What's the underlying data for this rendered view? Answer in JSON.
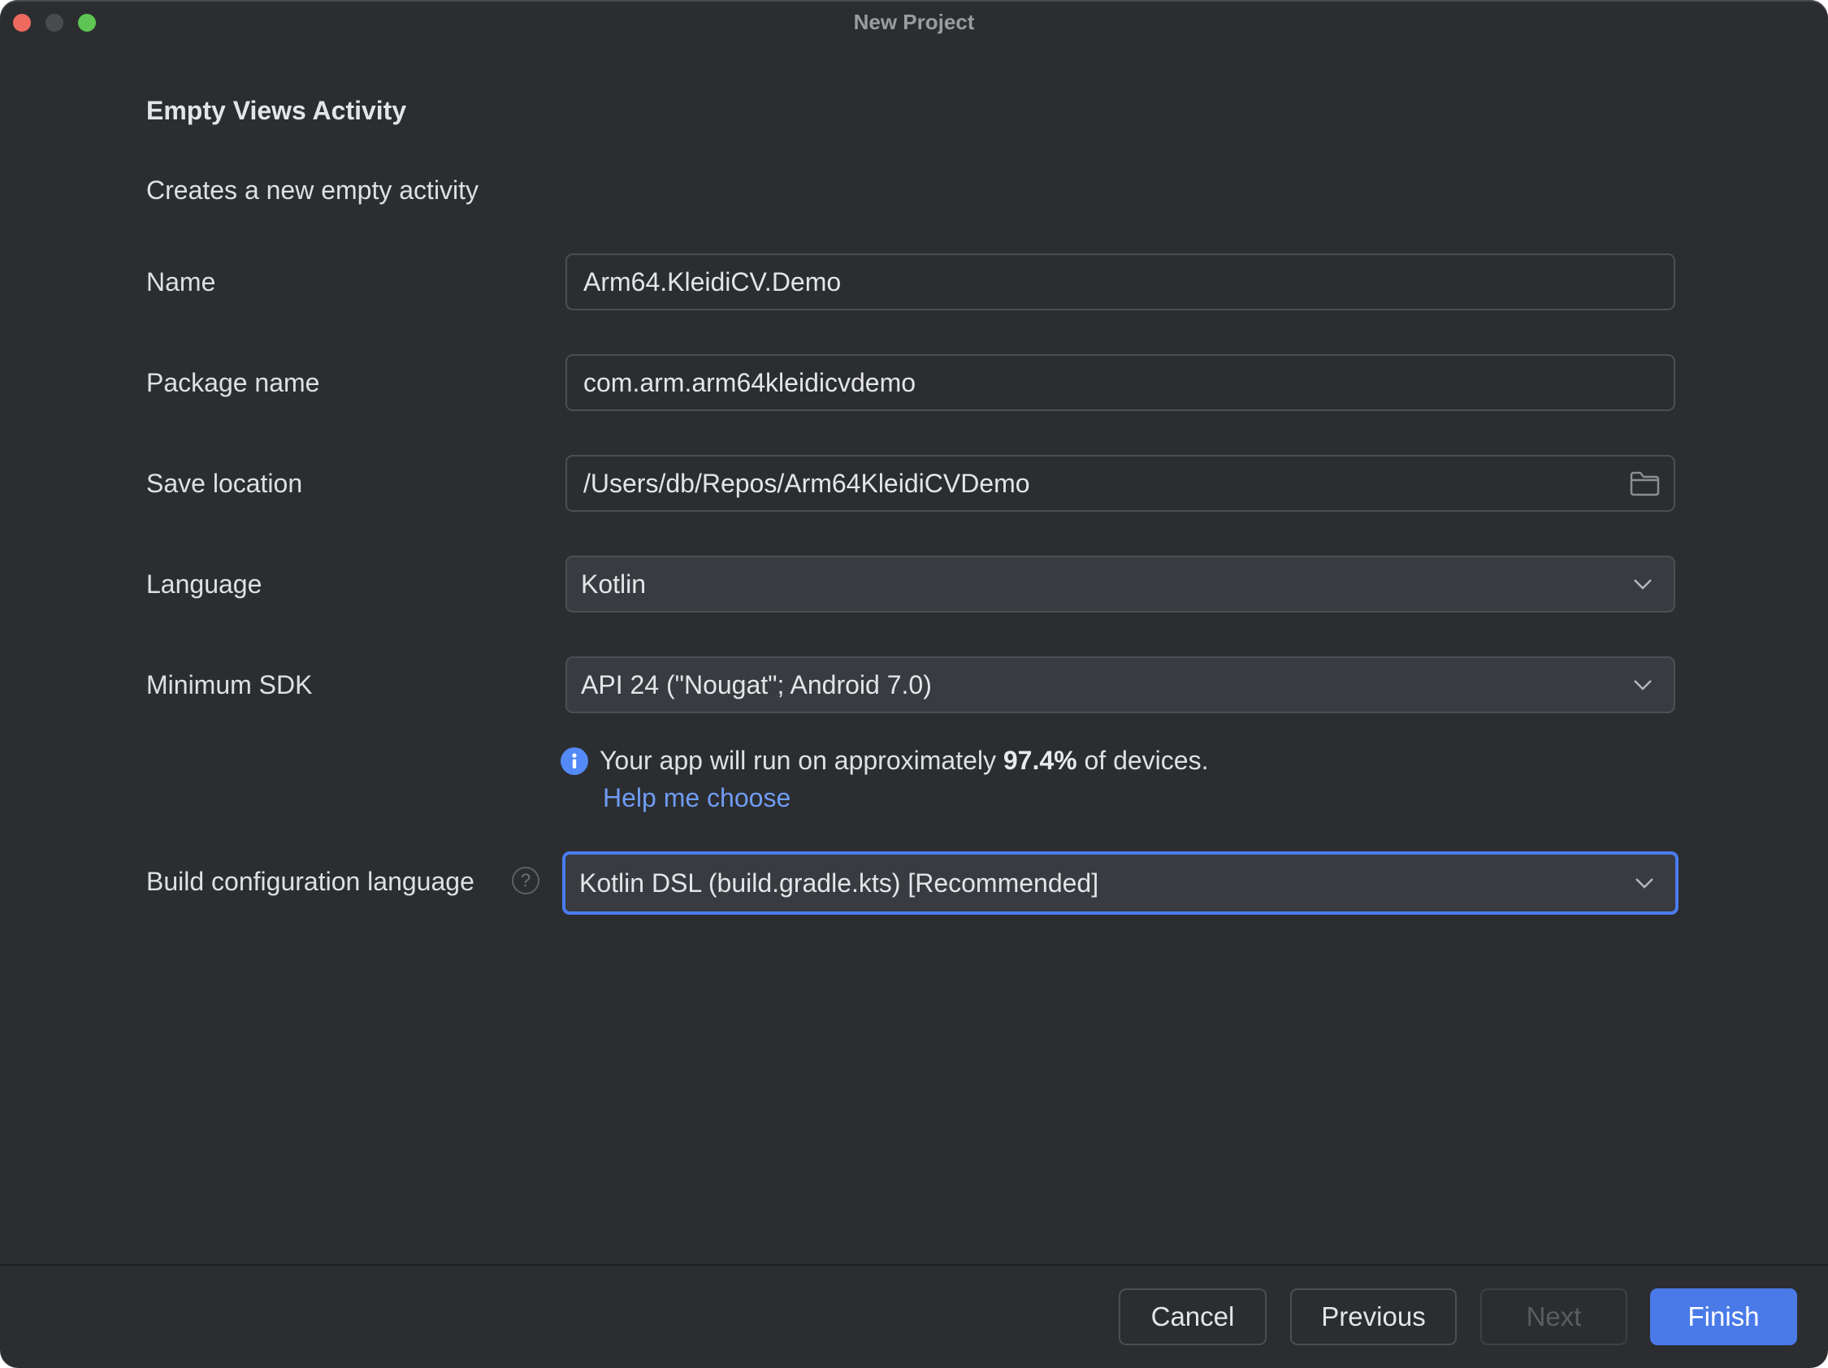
{
  "window": {
    "title": "New Project",
    "controls": [
      "close",
      "minimize",
      "maximize"
    ]
  },
  "header": {
    "title": "Empty Views Activity",
    "description": "Creates a new empty activity"
  },
  "form": {
    "name": {
      "label": "Name",
      "value": "Arm64.KleidiCV.Demo"
    },
    "package_name": {
      "label": "Package name",
      "value": "com.arm.arm64kleidicvdemo"
    },
    "save_location": {
      "label": "Save location",
      "value": "/Users/db/Repos/Arm64KleidiCVDemo",
      "icon": "folder-icon"
    },
    "language": {
      "label": "Language",
      "selected": "Kotlin",
      "icon": "chevron-down-icon"
    },
    "minimum_sdk": {
      "label": "Minimum SDK",
      "selected": "API 24 (\"Nougat\"; Android 7.0)",
      "icon": "chevron-down-icon"
    },
    "sdk_info": {
      "icon": "info-icon",
      "prefix": "Your app will run on approximately ",
      "percentage": "97.4%",
      "suffix": " of devices.",
      "link": "Help me choose"
    },
    "build_config_language": {
      "label": "Build configuration language",
      "help_icon": "question-icon",
      "selected": "Kotlin DSL (build.gradle.kts) [Recommended]",
      "focused": true
    }
  },
  "footer": {
    "cancel": "Cancel",
    "previous": "Previous",
    "next": "Next",
    "finish": "Finish"
  },
  "colors": {
    "background": "#2b2d30",
    "accent": "#4a7ae8",
    "link": "#6f9cf4",
    "info": "#548af7"
  }
}
